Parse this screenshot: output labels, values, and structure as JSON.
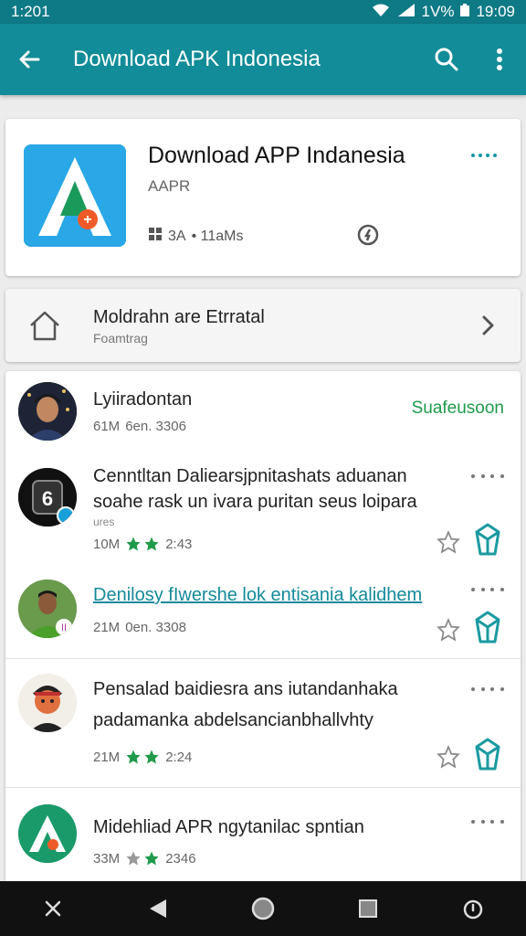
{
  "status_bar": {
    "time": "1:201",
    "battery_text": "1V%",
    "clock": "19:09"
  },
  "app_bar": {
    "title": "Download APK Indonesia",
    "icons": [
      "back-arrow-icon",
      "search-icon",
      "overflow-menu-icon"
    ]
  },
  "hero": {
    "app_name": "Download APP Indanesia",
    "developer": "AAPR",
    "size": "3A",
    "downloads": "• 11aMs",
    "icons": [
      "app-logo",
      "grid-icon",
      "verified-badge-icon",
      "more-dots-icon"
    ]
  },
  "install_row": {
    "title": "Moldrahn are Etrratal",
    "subtitle": "Foamtrag"
  },
  "list": {
    "items": [
      {
        "title": "Lyiiradontan",
        "size": "61M",
        "meta": "6en. 3306",
        "status": "Suafeusoon"
      },
      {
        "title_line1": "Cenntltan Daliearsjpnitashats aduanan",
        "title_line2": "soahe rask un ivara puritan seus loipara",
        "small": "ures",
        "size": "10M",
        "meta": "2:43"
      },
      {
        "title": "Denilosy fIwershe lok entisania kalidhem",
        "size": "21M",
        "meta": "0en. 3308"
      },
      {
        "title_line1": "Pensalad baidiesra ans iutandanhaka",
        "title_line2": "padamanka abdelsancianbhallvhty",
        "size": "21M",
        "meta": "2:24"
      },
      {
        "title": "Midehliad APR ngytanilac spntian",
        "size": "33M",
        "meta": "2346"
      }
    ]
  },
  "colors": {
    "appbar": "#128c98",
    "statusbar": "#0e7a86",
    "accent": "#1794a2",
    "green": "#1f9a4a",
    "teal_icon": "#1a9aa0"
  },
  "nav_bar": {
    "icons": [
      "scissors-icon",
      "back-triangle-icon",
      "home-circle-icon",
      "recents-square-icon",
      "power-icon"
    ]
  }
}
